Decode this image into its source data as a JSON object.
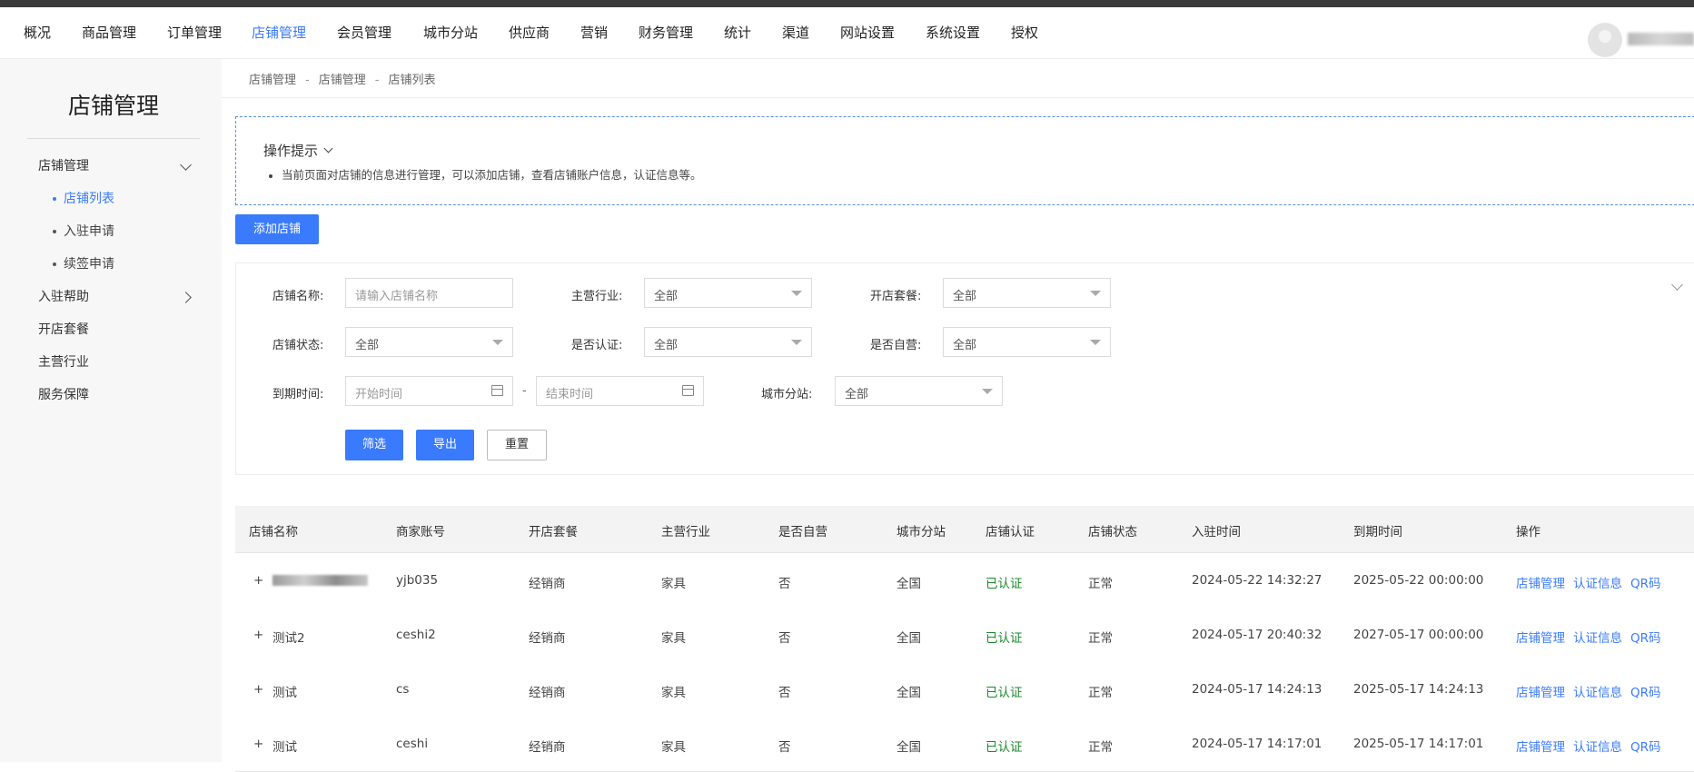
{
  "top_nav": {
    "items": [
      {
        "label": "概况",
        "active": false
      },
      {
        "label": "商品管理",
        "active": false
      },
      {
        "label": "订单管理",
        "active": false
      },
      {
        "label": "店铺管理",
        "active": true
      },
      {
        "label": "会员管理",
        "active": false
      },
      {
        "label": "城市分站",
        "active": false
      },
      {
        "label": "供应商",
        "active": false
      },
      {
        "label": "营销",
        "active": false
      },
      {
        "label": "财务管理",
        "active": false
      },
      {
        "label": "统计",
        "active": false
      },
      {
        "label": "渠道",
        "active": false
      },
      {
        "label": "网站设置",
        "active": false
      },
      {
        "label": "系统设置",
        "active": false
      },
      {
        "label": "授权",
        "active": false
      }
    ]
  },
  "sidebar": {
    "title": "店铺管理",
    "items": [
      {
        "label": "店铺管理",
        "expanded": true
      },
      {
        "label": "入驻帮助",
        "expanded": false
      },
      {
        "label": "开店套餐"
      },
      {
        "label": "主营行业"
      },
      {
        "label": "服务保障"
      }
    ],
    "sub_items": [
      {
        "label": "店铺列表",
        "active": true
      },
      {
        "label": "入驻申请",
        "active": false
      },
      {
        "label": "续签申请",
        "active": false
      }
    ]
  },
  "breadcrumb": [
    "店铺管理",
    "店铺管理",
    "店铺列表"
  ],
  "breadcrumb_sep": "-",
  "tips": {
    "title": "操作提示",
    "text": "当前页面对店铺的信息进行管理，可以添加店铺，查看店铺账户信息，认证信息等。"
  },
  "add_button": "添加店铺",
  "filters": {
    "shop_name": {
      "label": "店铺名称:",
      "placeholder": "请输入店铺名称"
    },
    "industry": {
      "label": "主营行业:",
      "value": "全部"
    },
    "package": {
      "label": "开店套餐:",
      "value": "全部"
    },
    "status": {
      "label": "店铺状态:",
      "value": "全部"
    },
    "certified": {
      "label": "是否认证:",
      "value": "全部"
    },
    "self_run": {
      "label": "是否自营:",
      "value": "全部"
    },
    "expire": {
      "label": "到期时间:",
      "start_placeholder": "开始时间",
      "end_placeholder": "结束时间",
      "dash": "-"
    },
    "city": {
      "label": "城市分站:",
      "value": "全部"
    },
    "buttons": {
      "filter": "筛选",
      "export": "导出",
      "reset": "重置"
    }
  },
  "table": {
    "headers": [
      "店铺名称",
      "商家账号",
      "开店套餐",
      "主营行业",
      "是否自营",
      "城市分站",
      "店铺认证",
      "店铺状态",
      "入驻时间",
      "到期时间",
      "操作"
    ],
    "rows": [
      {
        "expand": "+",
        "name": "",
        "name_blurred": true,
        "account": "yjb035",
        "package": "经销商",
        "industry": "家具",
        "self_run": "否",
        "city": "全国",
        "cert": "已认证",
        "status": "正常",
        "join": "2024-05-22 14:32:27",
        "expire": "2025-05-22 00:00:00"
      },
      {
        "expand": "+",
        "name": "测试2",
        "name_blurred": false,
        "account": "ceshi2",
        "package": "经销商",
        "industry": "家具",
        "self_run": "否",
        "city": "全国",
        "cert": "已认证",
        "status": "正常",
        "join": "2024-05-17 20:40:32",
        "expire": "2027-05-17 00:00:00"
      },
      {
        "expand": "+",
        "name": "测试",
        "name_blurred": false,
        "account": "cs",
        "package": "经销商",
        "industry": "家具",
        "self_run": "否",
        "city": "全国",
        "cert": "已认证",
        "status": "正常",
        "join": "2024-05-17 14:24:13",
        "expire": "2025-05-17 14:24:13"
      },
      {
        "expand": "+",
        "name": "测试",
        "name_blurred": false,
        "account": "ceshi",
        "package": "经销商",
        "industry": "家具",
        "self_run": "否",
        "city": "全国",
        "cert": "已认证",
        "status": "正常",
        "join": "2024-05-17 14:17:01",
        "expire": "2025-05-17 14:17:01"
      }
    ],
    "actions": [
      "店铺管理",
      "认证信息",
      "QR码"
    ]
  },
  "colors": {
    "accent": "#3a7bfd",
    "certified": "#1a8a2a"
  }
}
